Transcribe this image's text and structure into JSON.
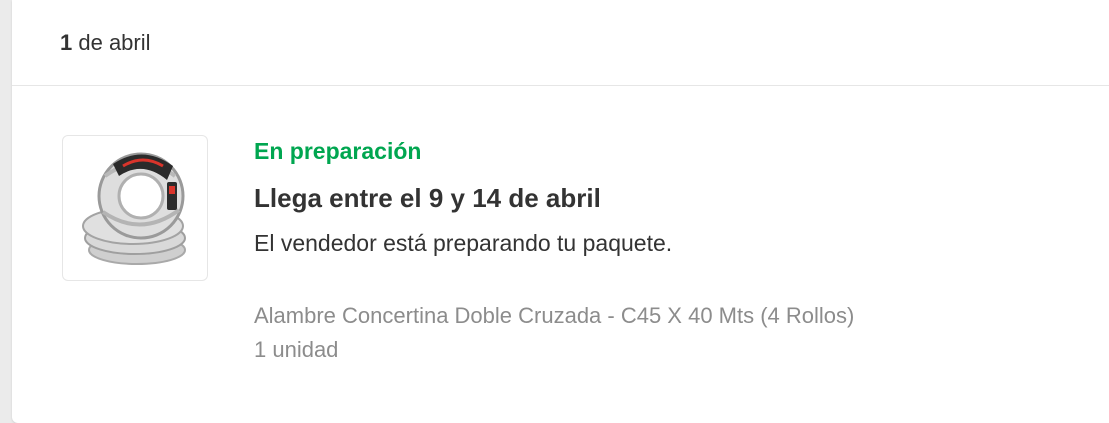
{
  "header": {
    "date_day": "1",
    "date_rest": " de abril"
  },
  "shipment": {
    "status": "En preparación",
    "title": "Llega entre el 9 y 14 de abril",
    "description": "El vendedor está preparando tu paquete.",
    "product_name": "Alambre Concertina Doble Cruzada - C45 X 40 Mts (4 Rollos)",
    "quantity": "1 unidad"
  },
  "colors": {
    "status": "#00a650",
    "text": "#333333",
    "muted": "#8c8c8c"
  }
}
